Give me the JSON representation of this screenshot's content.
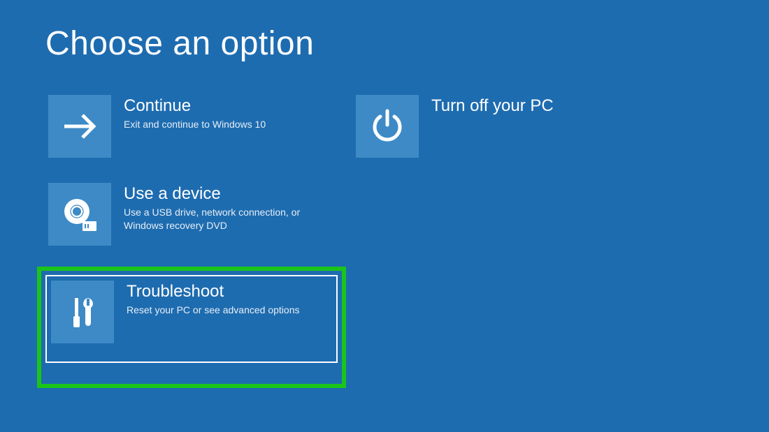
{
  "title": "Choose an option",
  "options": {
    "continue": {
      "title": "Continue",
      "desc": "Exit and continue to Windows 10"
    },
    "turnoff": {
      "title": "Turn off your PC",
      "desc": ""
    },
    "device": {
      "title": "Use a device",
      "desc": "Use a USB drive, network connection, or Windows recovery DVD"
    },
    "troubleshoot": {
      "title": "Troubleshoot",
      "desc": "Reset your PC or see advanced options"
    }
  },
  "colors": {
    "background": "#1e6cb0",
    "tile": "#3d8ac6",
    "highlight": "#1ac41a"
  }
}
